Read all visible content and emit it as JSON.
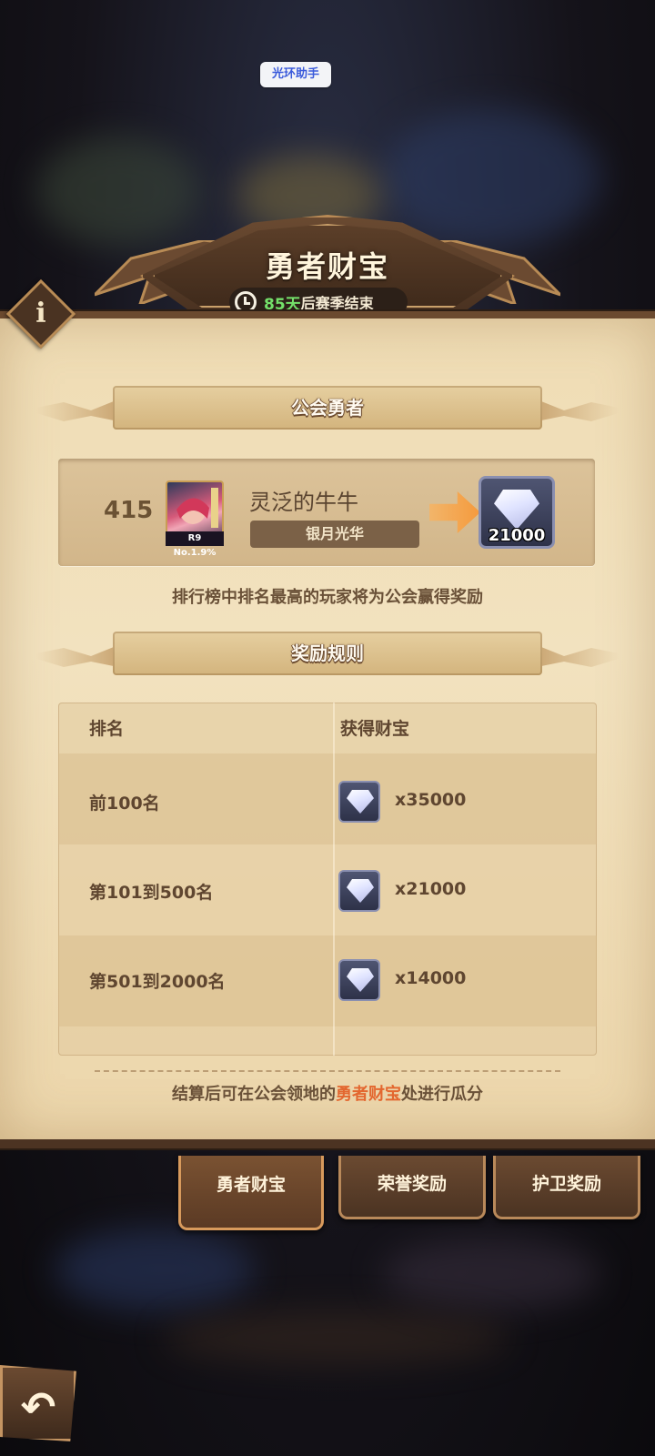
{
  "top_chip": {
    "label": "光环助手"
  },
  "header": {
    "title": "勇者财宝",
    "season_days": "85天",
    "season_suffix": "后赛季结束"
  },
  "guild_section": {
    "ribbon_label": "公会勇者",
    "rank": "415",
    "avatar_badge": "R9 No.1.9%",
    "player_name": "灵泛的牛牛",
    "player_title": "银月光华",
    "reward_count": "21000",
    "note": "排行榜中排名最高的玩家将为公会赢得奖励"
  },
  "rules_section": {
    "ribbon_label": "奖励规则",
    "headers": {
      "rank": "排名",
      "reward": "获得财宝"
    },
    "rows": [
      {
        "rank": "前100名",
        "reward": "x35000"
      },
      {
        "rank": "第101到500名",
        "reward": "x21000"
      },
      {
        "rank": "第501到2000名",
        "reward": "x14000"
      }
    ]
  },
  "footer": {
    "prefix": "结算后可在公会领地的",
    "highlight": "勇者财宝",
    "suffix": "处进行瓜分"
  },
  "tabs": [
    {
      "label": "勇者财宝",
      "active": true
    },
    {
      "label": "荣誉奖励",
      "active": false
    },
    {
      "label": "护卫奖励",
      "active": false
    }
  ],
  "icons": {
    "info": "info-icon",
    "clock": "clock-icon",
    "arrow": "arrow-right-icon",
    "gem": "diamond-icon",
    "back": "back-arrow-icon"
  },
  "colors": {
    "accent_highlight": "#e3672f",
    "season_days": "#74e06a",
    "parchment": "#efdcb4"
  }
}
